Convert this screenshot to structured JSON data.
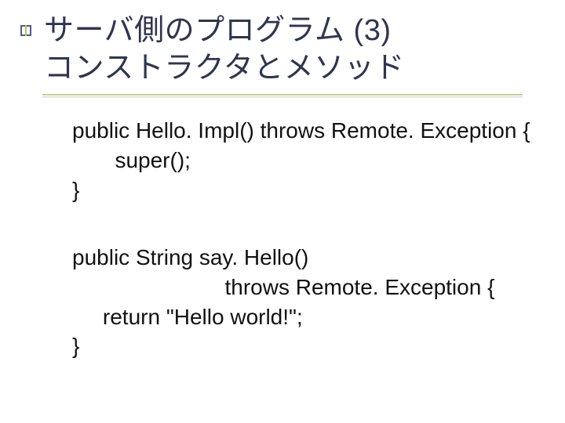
{
  "title": {
    "line1": "サーバ側のプログラム (3)",
    "line2": "コンストラクタとメソッド"
  },
  "code1": {
    "l1": "public Hello. Impl() throws Remote. Exception {",
    "l2": "       super();",
    "l3": "}"
  },
  "code2": {
    "l1": "public String say. Hello()",
    "l2": "                         throws Remote. Exception {",
    "l3": "     return \"Hello world!\";",
    "l4": "}"
  }
}
